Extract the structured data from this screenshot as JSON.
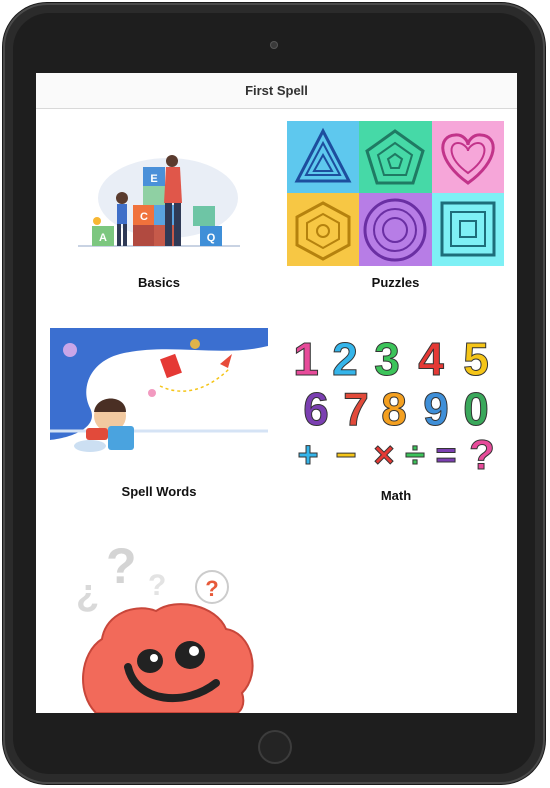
{
  "app": {
    "title": "First Spell"
  },
  "tiles": [
    {
      "id": "basics",
      "label": "Basics"
    },
    {
      "id": "puzzles",
      "label": "Puzzles"
    },
    {
      "id": "spell-words",
      "label": "Spell Words"
    },
    {
      "id": "math",
      "label": "Math"
    },
    {
      "id": "quiz",
      "label": ""
    }
  ],
  "illustrations": {
    "basics_blocks": [
      "E",
      "A",
      "C",
      "Q"
    ],
    "math_digits": [
      "1",
      "2",
      "3",
      "4",
      "5",
      "6",
      "7",
      "8",
      "9",
      "0"
    ],
    "math_symbols": [
      "+",
      "−",
      "×",
      "÷",
      "=",
      "?"
    ],
    "quiz_marks": [
      "?",
      "¿",
      "?",
      "?",
      "?"
    ]
  },
  "colors": {
    "puzzle_panels": [
      "#5ec8ee",
      "#46d9a7",
      "#f6a6d9",
      "#f7c744",
      "#b77de6",
      "#7ef0f5"
    ],
    "digit_colors": [
      "#e74b9a",
      "#35b5ea",
      "#3cc45a",
      "#e53935",
      "#f5c518",
      "#7b3fb1",
      "#e24a3a",
      "#f4a020",
      "#3f8fd8",
      "#3aa85b"
    ],
    "brain": "#f26a5a"
  }
}
